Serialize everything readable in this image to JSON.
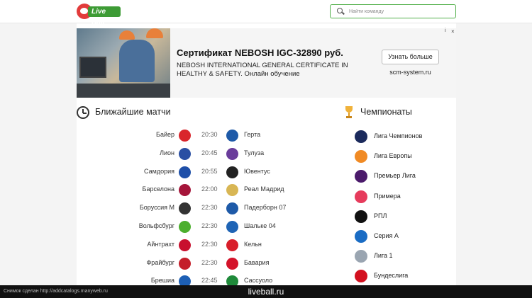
{
  "header": {
    "logo_text": "Live Ball",
    "search_placeholder": "Найти команду"
  },
  "ad": {
    "title": "Сертификат NEBOSH IGC-32890 руб.",
    "description": "NEBOSH INTERNATIONAL GENERAL CERTIFICATE IN HEALTHY & SAFETY. Онлайн обучение",
    "button_label": "Узнать больше",
    "domain": "scm-system.ru",
    "info_label": "i",
    "close_label": "×"
  },
  "matches": {
    "title": "Ближайшие матчи",
    "rows": [
      {
        "home": "Байер",
        "time": "20:30",
        "away": "Герта",
        "home_color": "#d9262c",
        "away_color": "#1e5aa8"
      },
      {
        "home": "Лион",
        "time": "20:45",
        "away": "Тулуза",
        "home_color": "#2a4fa3",
        "away_color": "#6a3c9b"
      },
      {
        "home": "Самдория",
        "time": "20:55",
        "away": "Ювентус",
        "home_color": "#1e4fa8",
        "away_color": "#222222"
      },
      {
        "home": "Барселона",
        "time": "22:00",
        "away": "Реал Мадрид",
        "home_color": "#a5153a",
        "away_color": "#d8b654"
      },
      {
        "home": "Боруссия М",
        "time": "22:30",
        "away": "Падерборн 07",
        "home_color": "#333333",
        "away_color": "#1e5aa8"
      },
      {
        "home": "Вольфсбург",
        "time": "22:30",
        "away": "Шальке 04",
        "home_color": "#4caf2e",
        "away_color": "#1f64b5"
      },
      {
        "home": "Айнтрахт",
        "time": "22:30",
        "away": "Кельн",
        "home_color": "#c8102e",
        "away_color": "#d81e2a"
      },
      {
        "home": "Фрайбург",
        "time": "22:30",
        "away": "Бавария",
        "home_color": "#c41e2a",
        "away_color": "#d4132a"
      },
      {
        "home": "Брешиа",
        "time": "22:45",
        "away": "Сассуоло",
        "home_color": "#1d5fb5",
        "away_color": "#1f8a3a"
      }
    ]
  },
  "championships": {
    "title": "Чемпионаты",
    "items": [
      {
        "name": "Лига Чемпионов",
        "color": "#1b2a5c"
      },
      {
        "name": "Лига Европы",
        "color": "#f08a24"
      },
      {
        "name": "Премьер Лига",
        "color": "#4b1a6b"
      },
      {
        "name": "Примера",
        "color": "#e63b5c"
      },
      {
        "name": "РПЛ",
        "color": "#111111"
      },
      {
        "name": "Серия А",
        "color": "#1a6cc4"
      },
      {
        "name": "Лига 1",
        "color": "#9aa5b1"
      },
      {
        "name": "Бундеслига",
        "color": "#d3101f"
      }
    ]
  },
  "footer": {
    "note": "Снимок сделан http://addcatalogs.manyweb.ru",
    "site": "liveball.ru"
  }
}
